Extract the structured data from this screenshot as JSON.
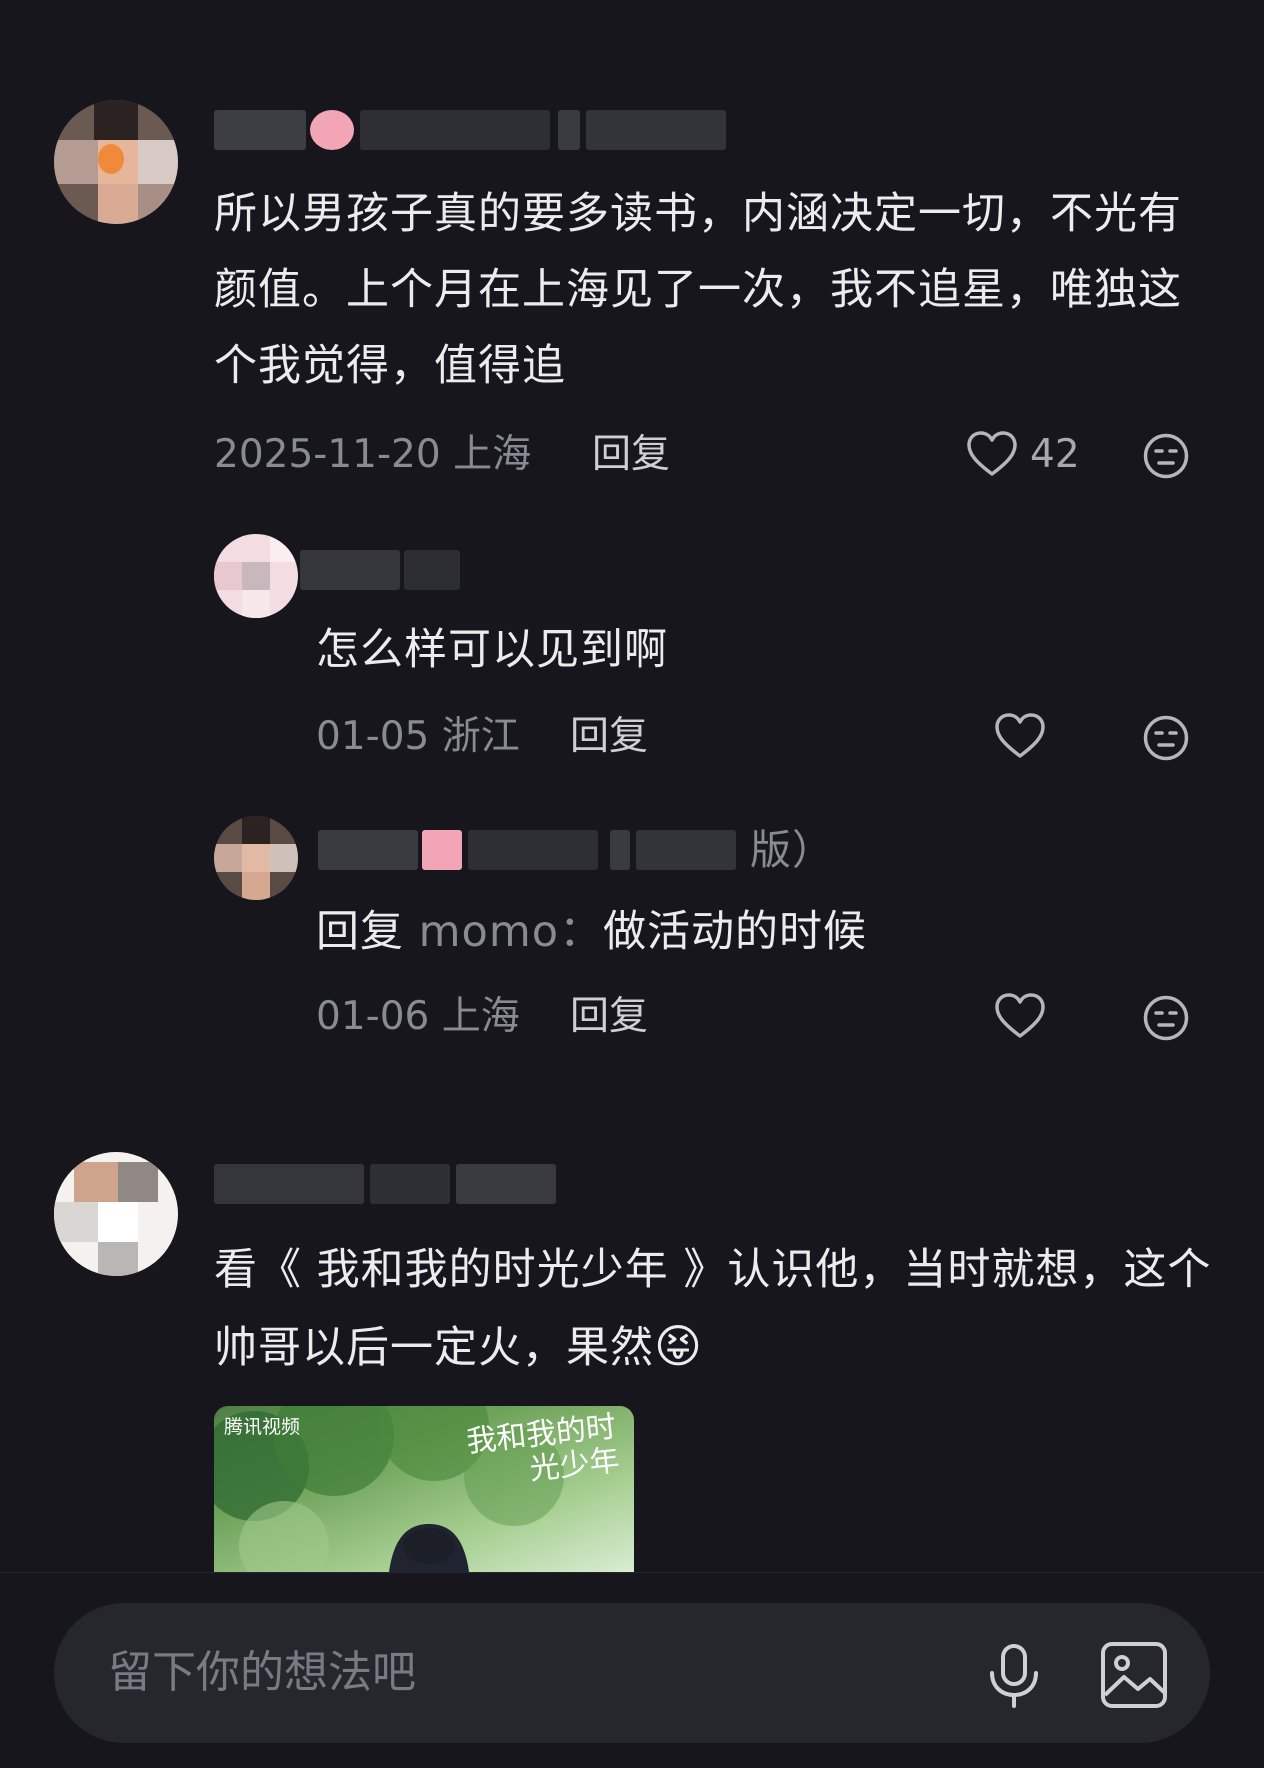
{
  "comments": [
    {
      "text": "所以男孩子真的要多读书，内涵决定一切，不光有颜值。上个月在上海见了一次，我不追星，唯独这个我觉得，值得追",
      "date": "2025-11-20",
      "location": "上海",
      "reply_label": "回复",
      "likes": "42",
      "like_icon": "heart-outline",
      "dislike_icon": "neutral-face",
      "replies": [
        {
          "text": "怎么样可以见到啊",
          "date": "01-05",
          "location": "浙江",
          "reply_label": "回复"
        },
        {
          "name_tail": "版）",
          "reply_prefix": "回复",
          "reply_target": "momo：",
          "text": "做活动的时候",
          "date": "01-06",
          "location": "上海",
          "reply_label": "回复"
        }
      ]
    },
    {
      "text": "看《 我和我的时光少年 》认识他，当时就想，这个帅哥以后一定火，果然",
      "emoji": "😝",
      "image": {
        "brand": "腾讯视频",
        "title": "我和我的时光少年"
      }
    }
  ],
  "input": {
    "placeholder": "留下你的想法吧",
    "mic_icon": "microphone",
    "image_icon": "image"
  }
}
